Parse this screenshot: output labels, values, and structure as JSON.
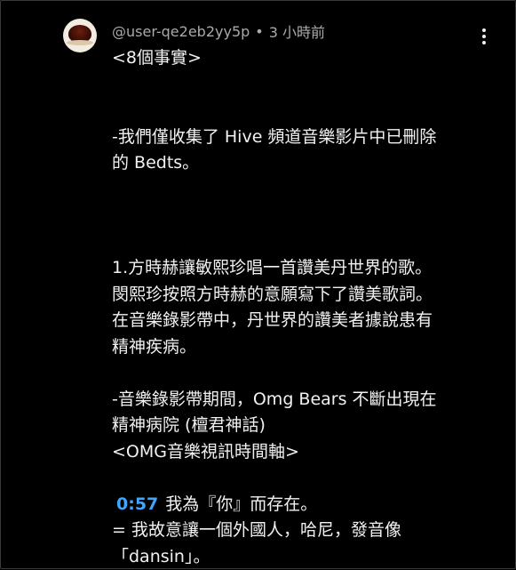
{
  "comment": {
    "author": "@user-qe2eb2yy5p",
    "separator": "•",
    "time": "3 小時前",
    "menu_icon": "more-vert-icon",
    "avatar_icon": "coffee-cup-avatar",
    "lines": [
      "<8個事實>",
      "",
      "",
      "-我們僅收集了 Hive 頻道音樂影片中已刪除",
      "的 Bedts。",
      "",
      "",
      "",
      "1.方時赫讓敏熙珍唱一首讚美丹世界的歌。",
      "閔熙珍按照方時赫的意願寫下了讚美歌詞。",
      "在音樂錄影帶中，丹世界的讚美者據說患有",
      "精神疾病。",
      "",
      "-音樂錄影帶期間，Omg Bears 不斷出現在",
      "精神病院 (檀君神話)",
      "<OMG音樂視訊時間軸>",
      ""
    ],
    "timestamp": "0:57",
    "timestamp_text": "我為『你』而存在。",
    "tail_lines": [
      "= 我故意讓一個外國人，哈尼，發音像",
      "「dansin」。"
    ]
  },
  "colors": {
    "background": "#000000",
    "text": "#f1f1f1",
    "meta": "#aaaaaa",
    "link": "#3ea6ff"
  }
}
